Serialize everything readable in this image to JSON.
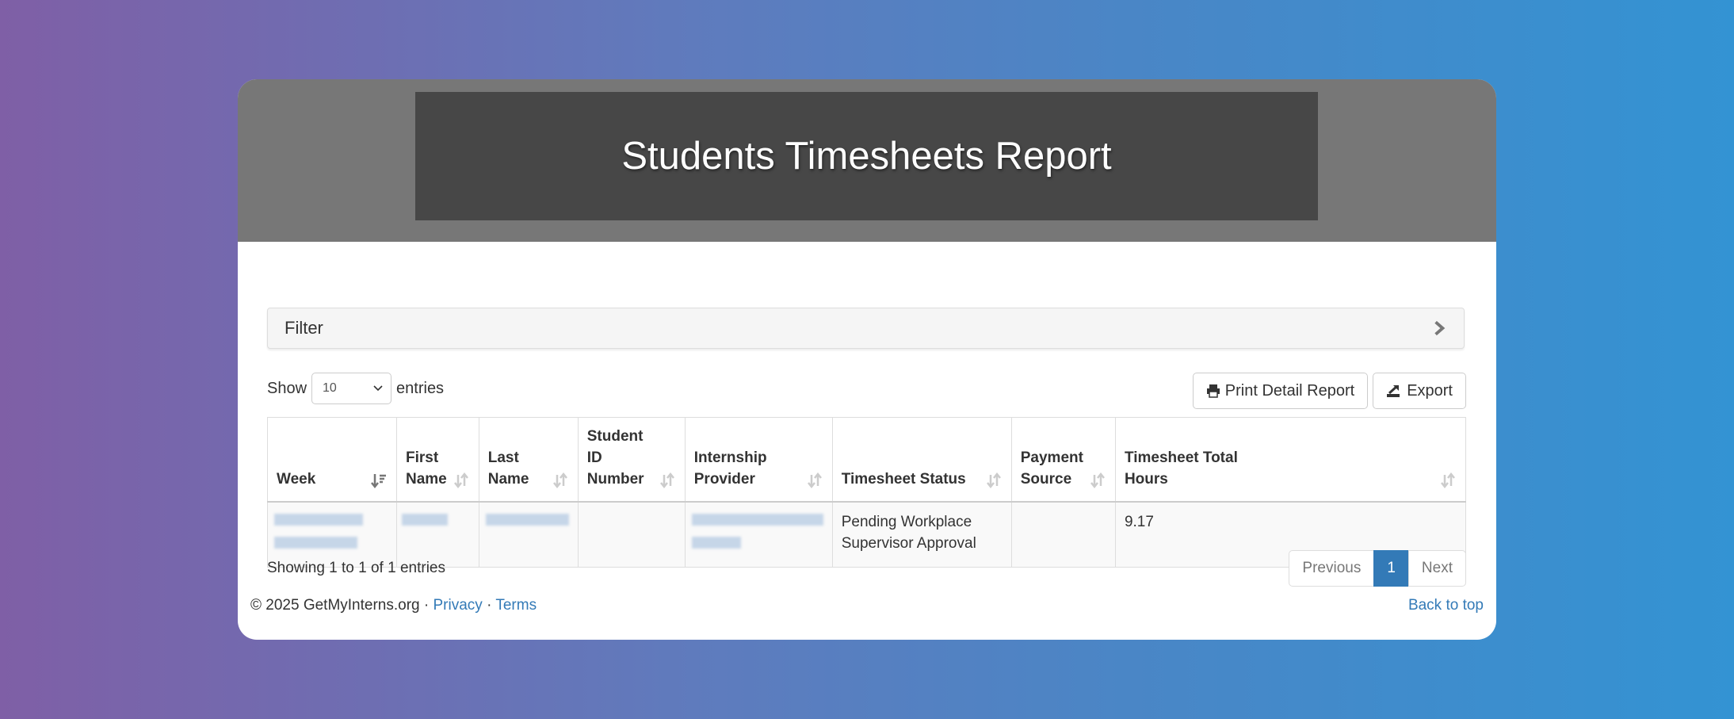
{
  "banner": {
    "title": "Students Timesheets Report"
  },
  "filter": {
    "label": "Filter"
  },
  "length": {
    "show": "Show",
    "value": "10",
    "entries": "entries"
  },
  "toolbar": {
    "print_label": "Print Detail Report",
    "export_label": "Export"
  },
  "table": {
    "headers": [
      [
        "Week",
        ""
      ],
      [
        "First",
        "Name"
      ],
      [
        "Last",
        "Name"
      ],
      [
        "Student ID",
        "Number"
      ],
      [
        "Internship",
        "Provider"
      ],
      [
        "Timesheet Status",
        ""
      ],
      [
        "Payment",
        "Source"
      ],
      [
        "Timesheet Total",
        "Hours"
      ]
    ],
    "rows": [
      {
        "status_line1": "Pending Workplace",
        "status_line2": "Supervisor Approval",
        "hours": "9.17"
      }
    ]
  },
  "info": "Showing 1 to 1 of 1 entries",
  "pagination": {
    "previous": "Previous",
    "current": "1",
    "next": "Next"
  },
  "footer": {
    "copyright": "© 2025 GetMyInterns.org ·",
    "privacy": "Privacy",
    "sep": "·",
    "terms": "Terms",
    "back_to_top": "Back to top"
  },
  "colors": {
    "accent": "#337ab7",
    "banner_dark": "#474747",
    "banner": "#777777"
  }
}
